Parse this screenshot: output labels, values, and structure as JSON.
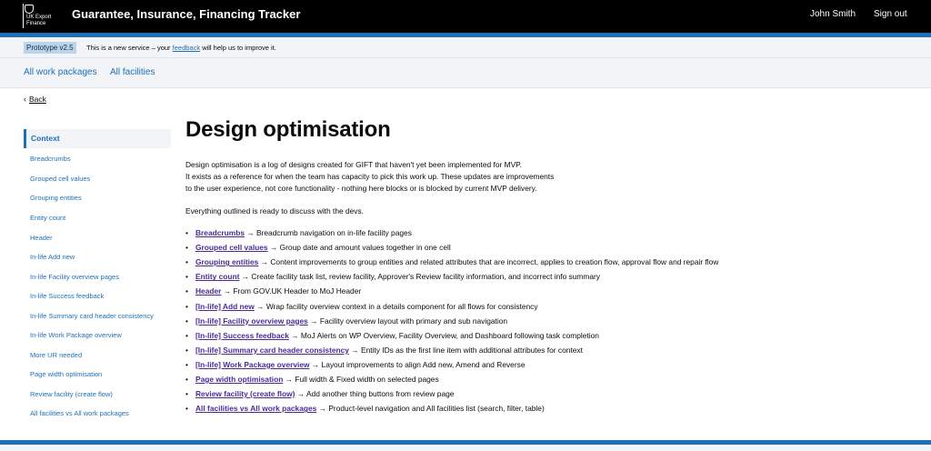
{
  "header": {
    "logo_line1": "UK Export",
    "logo_line2": "Finance",
    "service_name": "Guarantee, Insurance, Financing Tracker",
    "user_name": "John Smith",
    "sign_out": "Sign out"
  },
  "phase_banner": {
    "tag": "Prototype v2.5",
    "text_before": "This is a new service – your",
    "link": "feedback",
    "text_after": "will help us to improve it."
  },
  "primary_nav": {
    "work_packages": "All work packages",
    "facilities": "All facilities"
  },
  "back_link": "Back",
  "side_nav": {
    "items": [
      "Context",
      "Breadcrumbs",
      "Grouped cell values",
      "Grouping entities",
      "Entity count",
      "Header",
      "In-life Add new",
      "In-life Facility overview pages",
      "In-life Success feedback",
      "In-life Summary card header consistency",
      "In-life Work Package overview",
      "More UR needed",
      "Page width optimisation",
      "Review facility (create flow)",
      "All facilities vs All work packages"
    ],
    "active_index": 0
  },
  "main": {
    "title": "Design optimisation",
    "intro_lines": [
      "Design optimisation is a log of designs created for GIFT that haven't yet been implemented for MVP.",
      "It exists as a reference for when the team has capacity to pick this work up. These updates are improvements",
      "to the user experience, not core functionality - nothing here blocks or is blocked by current MVP delivery."
    ],
    "ready_text": "Everything outlined is ready to discuss with the devs.",
    "items": [
      {
        "link": "Breadcrumbs",
        "desc": " → Breadcrumb navigation on in-life facility pages"
      },
      {
        "link": "Grouped cell values",
        "desc": " → Group date and amount values together in one cell"
      },
      {
        "link": "Grouping entities",
        "desc": " → Content improvements to group entities and related attributes that are incorrect, applies to creation flow, approval flow and repair flow"
      },
      {
        "link": "Entity count",
        "desc": " → Create facility task list, review facility, Approver's Review facility information, and incorrect info summary"
      },
      {
        "link": "Header",
        "desc": " → From GOV.UK Header to MoJ Header"
      },
      {
        "link": "[In-life] Add new",
        "desc": " → Wrap facility overview context in a details component for all flows for consistency"
      },
      {
        "link": "[In-life] Facility overview pages",
        "desc": " → Facility overview layout with primary and sub navigation"
      },
      {
        "link": "[In-life] Success feedback",
        "desc": " → MoJ Alerts on WP Overview, Facility Overview, and Dashboard following task completion"
      },
      {
        "link": "[In-life] Summary card header consistency",
        "desc": " → Entity IDs as the first line item with additional attributes for context"
      },
      {
        "link": "[In-life] Work Package overview",
        "desc": " → Layout improvements to align Add new, Amend and Reverse"
      },
      {
        "link": "Page width optimisation",
        "desc": " → Full width & Fixed width on selected pages"
      },
      {
        "link": "Review facility (create flow)",
        "desc": " → Add another thing buttons from review page"
      },
      {
        "link": "All facilities vs All work packages",
        "desc": " → Product-level navigation and All facilities list (search, filter, table)"
      }
    ]
  },
  "colors": {
    "header_bg": "#000000",
    "brand_blue": "#1d70b8",
    "link_visited": "#4c2c92",
    "banner_bg": "#f3f4f7"
  }
}
